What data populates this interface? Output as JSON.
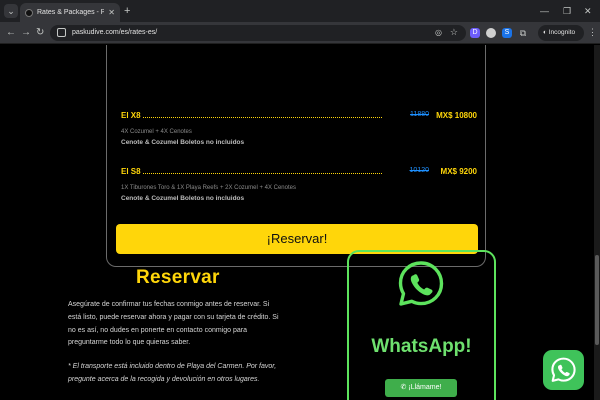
{
  "browser": {
    "tab_title": "Rates & Packages - Pasku Dive",
    "url": "paskudive.com/es/rates-es/",
    "incognito_label": "Incognito",
    "ext_d_label": "D",
    "ext_s_label": "S"
  },
  "packages": [
    {
      "name": "El X8",
      "old_price": "11880",
      "new_price": "MX$ 10800",
      "detail": "4X Cozumel + 4X Cenotes",
      "note": "Cenote & Cozumel Boletos no incluidos"
    },
    {
      "name": "El S8",
      "old_price": "10120",
      "new_price": "MX$ 9200",
      "detail": "1X Tiburones Toro & 1X Playa Reefs + 2X Cozumel + 4X Cenotes",
      "note": "Cenote & Cozumel Boletos no incluidos"
    }
  ],
  "reserve_button": "¡Reservar!",
  "reservar_section": {
    "title": "Reservar",
    "paragraph": "Asegúrate de confirmar tus fechas conmigo antes de reservar. Si está listo, puede reservar ahora y pagar con su tarjeta de crédito. Si no es así, no dudes en ponerte en contacto conmigo para preguntarme todo lo que quieras saber.",
    "note": "* El transporte está incluido dentro de Playa del Carmen. Por favor, pregunte acerca de la recogida y devolución en otros lugares."
  },
  "whatsapp": {
    "title": "WhatsApp!",
    "button": "✆ ¡Llámame!"
  },
  "colors": {
    "accent_yellow": "#ffd60a",
    "whatsapp_green": "#3fc35a",
    "old_price_blue": "#1e90ff",
    "background": "#000000"
  }
}
